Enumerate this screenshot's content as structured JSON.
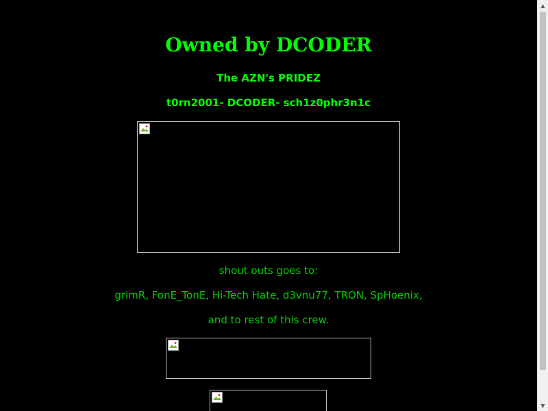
{
  "page": {
    "title": "Owned by DCODER",
    "subtitle": "The AZN's PRIDEZ",
    "members": "t0rn2001- DCODER- sch1z0phr3n1c",
    "shoutouts_intro": "shout outs goes to:",
    "shoutouts_names": "grimR, FonE_TonE, Hi-Tech Hate, d3vnu77, TRON, SpHoenix,",
    "shoutouts_outro": "and to rest of this crew."
  },
  "images": [
    {
      "name": "broken-image-1",
      "icon": "broken-image-icon"
    },
    {
      "name": "broken-image-2",
      "icon": "broken-image-icon"
    },
    {
      "name": "broken-image-3",
      "icon": "broken-image-icon"
    }
  ],
  "scrollbar": {
    "up_arrow_icon": "chevron-up-icon",
    "down_arrow_icon": "chevron-down-icon"
  },
  "colors": {
    "background": "#000000",
    "heading_text": "#00ff00",
    "body_text": "#00cc00",
    "scrollbar_track": "#f0f0f0",
    "scrollbar_thumb": "#c1c1c1"
  }
}
